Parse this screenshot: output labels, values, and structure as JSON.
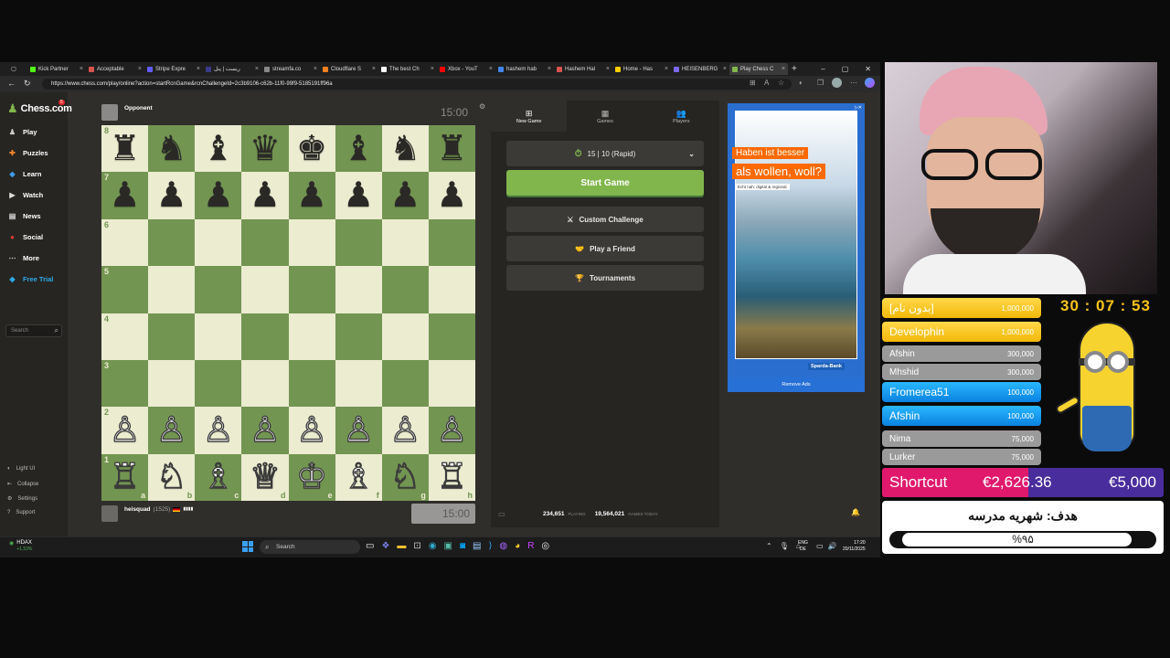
{
  "tabs": [
    {
      "label": "Kick Partner",
      "color": "#53fc18"
    },
    {
      "label": "Acceptable",
      "color": "#d9534f"
    },
    {
      "label": "Stripe Expre",
      "color": "#635bff"
    },
    {
      "label": "ریست | پنل",
      "color": "#3a3a8a"
    },
    {
      "label": "streamfa.co",
      "color": "#888888"
    },
    {
      "label": "Cloudflare S",
      "color": "#f48120"
    },
    {
      "label": "The best Ch",
      "color": "#ffffff"
    },
    {
      "label": "Xbox - YouT",
      "color": "#ff0000"
    },
    {
      "label": "hashem hab",
      "color": "#4285f4"
    },
    {
      "label": "Hashem Hal",
      "color": "#d9534f"
    },
    {
      "label": "Home - Has",
      "color": "#ffcc00"
    },
    {
      "label": "HEISENBERG",
      "color": "#7b68ee"
    },
    {
      "label": "Play Chess C",
      "color": "#81b64c"
    }
  ],
  "url": "https://www.chess.com/play/online?action=startRcnGame&rcnChallengeId=2c3b9106-c62b-11f0-99f9-5185191ff96a",
  "logo": "Chess.com",
  "logo_badge": "5",
  "nav": [
    {
      "label": "Play",
      "icon": "pawn-icon",
      "color": "#cccccc"
    },
    {
      "label": "Puzzles",
      "icon": "puzzle-icon",
      "color": "#f7842a"
    },
    {
      "label": "Learn",
      "icon": "learn-icon",
      "color": "#3d9be9"
    },
    {
      "label": "Watch",
      "icon": "watch-icon",
      "color": "#dddddd"
    },
    {
      "label": "News",
      "icon": "news-icon",
      "color": "#dddddd"
    },
    {
      "label": "Social",
      "icon": "social-icon",
      "color": "#e03b3b"
    },
    {
      "label": "More",
      "icon": "more-icon",
      "color": "#dddddd"
    },
    {
      "label": "Free Trial",
      "icon": "diamond-icon",
      "color": "#2ea9e8"
    }
  ],
  "search_placeholder": "Search",
  "bottom_nav": [
    "Light UI",
    "Collapse",
    "Settings",
    "Support"
  ],
  "opponent": {
    "name": "Opponent",
    "clock": "15:00"
  },
  "player": {
    "name": "heisquad",
    "rating": "(1525)",
    "clock": "15:00"
  },
  "board": {
    "ranks": [
      "8",
      "7",
      "6",
      "5",
      "4",
      "3",
      "2",
      "1"
    ],
    "files": [
      "a",
      "b",
      "c",
      "d",
      "e",
      "f",
      "g",
      "h"
    ],
    "rows": [
      [
        "♜",
        "♞",
        "♝",
        "♛",
        "♚",
        "♝",
        "♞",
        "♜"
      ],
      [
        "♟",
        "♟",
        "♟",
        "♟",
        "♟",
        "♟",
        "♟",
        "♟"
      ],
      [
        "",
        "",
        "",
        "",
        "",
        "",
        "",
        ""
      ],
      [
        "",
        "",
        "",
        "",
        "",
        "",
        "",
        ""
      ],
      [
        "",
        "",
        "",
        "",
        "",
        "",
        "",
        ""
      ],
      [
        "",
        "",
        "",
        "",
        "",
        "",
        "",
        ""
      ],
      [
        "♙",
        "♙",
        "♙",
        "♙",
        "♙",
        "♙",
        "♙",
        "♙"
      ],
      [
        "♖",
        "♘",
        "♗",
        "♕",
        "♔",
        "♗",
        "♘",
        "♖"
      ]
    ]
  },
  "panel": {
    "tabs": [
      "New Game",
      "Games",
      "Players"
    ],
    "time_control": "15 | 10 (Rapid)",
    "start": "Start Game",
    "custom": "Custom Challenge",
    "friend": "Play a Friend",
    "tournaments": "Tournaments",
    "playing_count": "234,651",
    "playing_label": "PLAYING",
    "games_count": "19,564,021",
    "games_label": "GAMES TODAY"
  },
  "ad": {
    "line1": "Haben ist besser",
    "line2": "als wollen, woll?",
    "sub": "Echt nah: digital & regional",
    "brand": "Sparda-Bank",
    "remove": "Remove Ads"
  },
  "taskbar": {
    "ticker": "HDAX",
    "change": "+1,53%",
    "search": "Search",
    "lang1": "ENG",
    "lang2": "DE",
    "time": "17:20",
    "date": "20/11/2025"
  },
  "stream": {
    "timer": "30 : 07 : 53",
    "donors": [
      {
        "name": "[بدون نام]",
        "amount": "1,000,000"
      },
      {
        "name": "Develophin",
        "amount": "1,000,000"
      },
      {
        "name": "Afshin",
        "amount": "300,000"
      },
      {
        "name": "Mhshid",
        "amount": "300,000"
      },
      {
        "name": "Fromerea51",
        "amount": "100,000"
      },
      {
        "name": "Afshin",
        "amount": "100,000"
      },
      {
        "name": "Nima",
        "amount": "75,000"
      },
      {
        "name": "Lurker",
        "amount": "75,000"
      }
    ],
    "shortcut_label": "Shortcut",
    "shortcut_current": "€2,626.36",
    "shortcut_goal": "€5,000",
    "goal_title": "هدف: شهریه مدرسه",
    "goal_percent": "%۹۵",
    "goal_progress": 0.95
  }
}
